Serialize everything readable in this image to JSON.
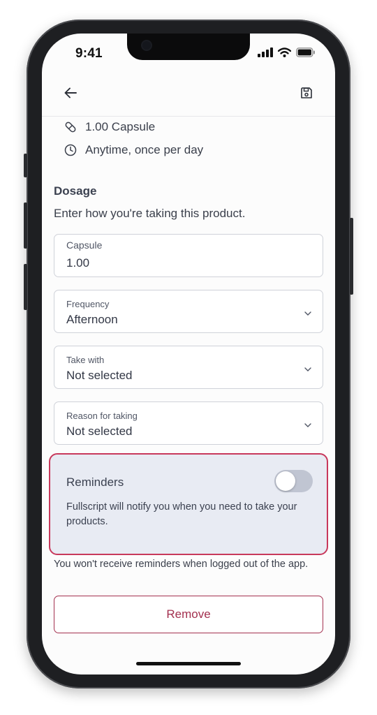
{
  "status_bar": {
    "time": "9:41"
  },
  "summary": {
    "amount": "1.00 Capsule",
    "schedule": "Anytime, once per day"
  },
  "dosage": {
    "title": "Dosage",
    "description": "Enter how you're taking this product.",
    "fields": [
      {
        "label": "Capsule",
        "value": "1.00"
      },
      {
        "label": "Frequency",
        "value": "Afternoon"
      },
      {
        "label": "Take with",
        "value": "Not selected"
      },
      {
        "label": "Reason for taking",
        "value": "Not selected"
      }
    ]
  },
  "reminders": {
    "title": "Reminders",
    "description": "Fullscript will notify you when you need to take your products.",
    "enabled": false
  },
  "note": "You won't receive reminders when logged out of the app.",
  "remove_label": "Remove",
  "colors": {
    "accent": "#a3304f",
    "highlight_border": "#c8385b",
    "reminders_bg": "#e8ebf3"
  }
}
